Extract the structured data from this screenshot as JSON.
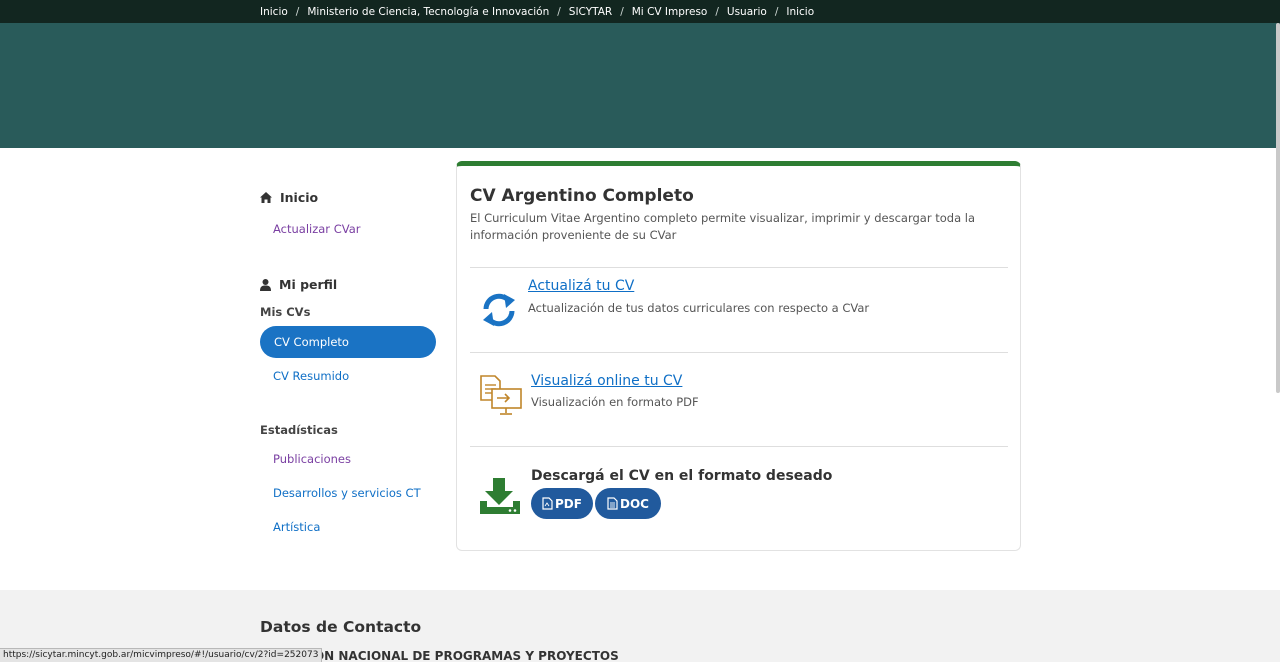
{
  "breadcrumb": [
    "Inicio",
    "Ministerio de Ciencia, Tecnología e Innovación",
    "SICYTAR",
    "Mi CV Impreso",
    "Usuario",
    "Inicio"
  ],
  "breadcrumb_separator": "/",
  "sidebar": {
    "home_heading": "Inicio",
    "home_link": "Actualizar CVar",
    "profile_heading": "Mi perfil",
    "my_cvs_label": "Mis CVs",
    "cv_complete": "CV Completo",
    "cv_summary": "CV Resumido",
    "stats_label": "Estadísticas",
    "stats_items": [
      "Publicaciones",
      "Desarrollos y servicios CT",
      "Artística"
    ]
  },
  "card": {
    "title": "CV Argentino Completo",
    "description": "El Curriculum Vitae Argentino completo permite visualizar, imprimir y descargar toda la información proveniente de su CVar",
    "update": {
      "link": "Actualizá tu CV",
      "text": "Actualización de tus datos curriculares con respecto a CVar",
      "icon": "sync-icon"
    },
    "view": {
      "link": "Visualizá online tu CV",
      "text": "Visualización en formato PDF",
      "icon": "document-monitor-icon"
    },
    "download": {
      "heading": "Descargá el CV en el formato deseado",
      "pdf_label": "PDF",
      "doc_label": "DOC",
      "icon": "download-tray-icon"
    }
  },
  "footer": {
    "title": "Datos de Contacto",
    "subtitle": "DIRECCIÓN NACIONAL DE PROGRAMAS Y PROYECTOS"
  },
  "status_url": "https://sicytar.mincyt.gob.ar/micvimpreso/#!/usuario/cv/2?id=252073",
  "colors": {
    "topbar": "#122620",
    "hero": "#295b5a",
    "active_nav": "#1a73c4",
    "card_accent": "#2e7d32",
    "download_button": "#215a9d",
    "link": "#0f6fc6",
    "visited_link": "#7a3fa2"
  }
}
